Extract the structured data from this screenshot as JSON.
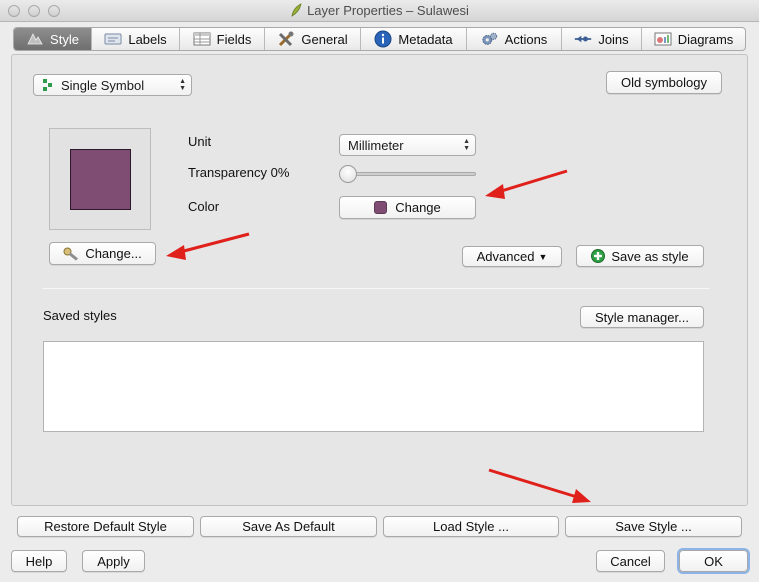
{
  "window": {
    "title": "Layer Properties – Sulawesi"
  },
  "tabs": [
    {
      "label": "Style",
      "icon": "style-icon",
      "active": true
    },
    {
      "label": "Labels",
      "icon": "labels-icon"
    },
    {
      "label": "Fields",
      "icon": "fields-icon"
    },
    {
      "label": "General",
      "icon": "general-tools-icon"
    },
    {
      "label": "Metadata",
      "icon": "info-icon"
    },
    {
      "label": "Actions",
      "icon": "gears-icon"
    },
    {
      "label": "Joins",
      "icon": "joins-icon"
    },
    {
      "label": "Diagrams",
      "icon": "diagrams-icon"
    }
  ],
  "style_panel": {
    "renderer_selected": "Single Symbol",
    "old_symbology_label": "Old symbology",
    "unit_label": "Unit",
    "unit_value": "Millimeter",
    "transparency_label": "Transparency 0%",
    "transparency_value": 0,
    "color_label": "Color",
    "color_button_label": "Change",
    "symbol_color": "#7f4d74",
    "change_symbol_label": "Change...",
    "advanced_label": "Advanced",
    "save_as_style_label": "Save as style",
    "saved_styles_label": "Saved styles",
    "style_manager_label": "Style manager..."
  },
  "bottom_buttons": {
    "restore_default": "Restore Default Style",
    "save_as_default": "Save As Default",
    "load_style": "Load Style ...",
    "save_style": "Save Style ..."
  },
  "dialog_buttons": {
    "help": "Help",
    "apply": "Apply",
    "cancel": "Cancel",
    "ok": "OK"
  },
  "annotation_color": "#e0201b"
}
